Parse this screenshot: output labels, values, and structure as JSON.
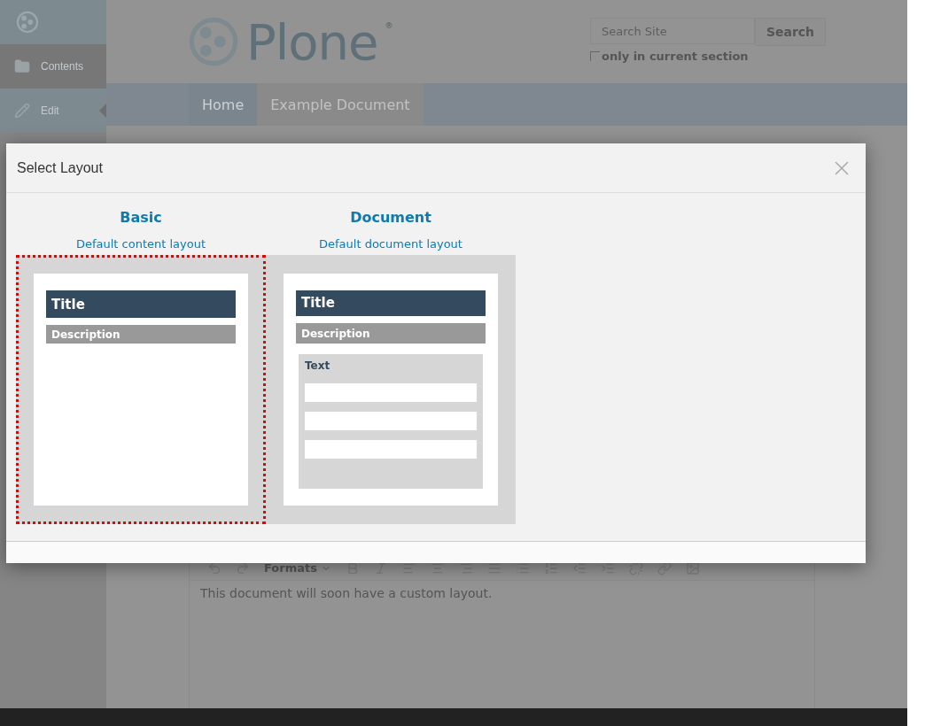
{
  "toolbar": {
    "items": [
      {
        "kind": "contents",
        "label": "Contents",
        "selected": false
      },
      {
        "kind": "edit",
        "label": "Edit",
        "selected": true
      }
    ]
  },
  "site": {
    "logo_text": "Plone",
    "registered": "®",
    "search": {
      "placeholder": "Search Site",
      "button": "Search",
      "only_current_section": {
        "label": "only in current section",
        "checked": false
      }
    }
  },
  "nav": {
    "tabs": [
      {
        "label": "Home",
        "selected": false
      },
      {
        "label": "Example Document",
        "selected": true
      }
    ]
  },
  "editor": {
    "formats": "Formats",
    "body": "This document will soon have a custom layout."
  },
  "modal": {
    "title": "Select Layout",
    "layouts": [
      {
        "kind": "basic",
        "name": "Basic",
        "description": "Default content layout",
        "selected": true,
        "preview": {
          "title": "Title",
          "description": "Description"
        }
      },
      {
        "kind": "document",
        "name": "Document",
        "description": "Default document layout",
        "selected": false,
        "preview": {
          "title": "Title",
          "description": "Description",
          "text": "Text"
        }
      }
    ]
  }
}
